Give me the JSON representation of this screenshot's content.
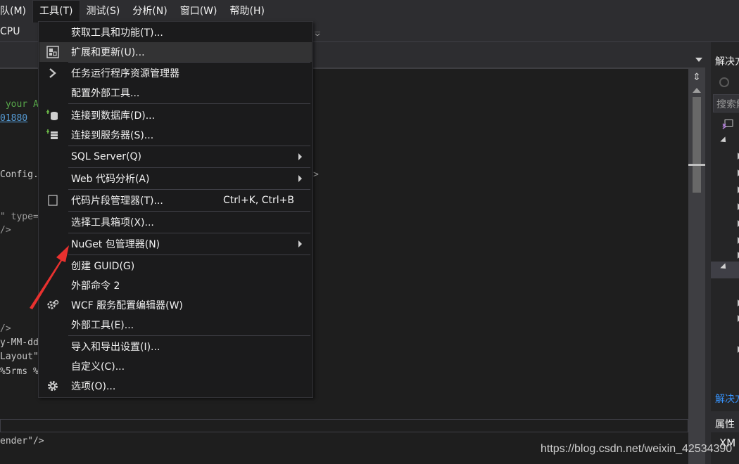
{
  "menubar": {
    "items": [
      {
        "label": "队(M)"
      },
      {
        "label": "工具(T)"
      },
      {
        "label": "测试(S)"
      },
      {
        "label": "分析(N)"
      },
      {
        "label": "窗口(W)"
      },
      {
        "label": "帮助(H)"
      }
    ]
  },
  "toolbar": {
    "platform": "CPU"
  },
  "editor": {
    "lines": [
      {
        "text": " your A",
        "style": "green"
      },
      {
        "text": "01880",
        "style": "link"
      },
      {
        "text": "Config.N",
        "style": "val"
      },
      {
        "text": "\" type=",
        "style": "gray"
      },
      {
        "text": "/>",
        "style": "gray"
      },
      {
        "text": "/>",
        "style": "gray"
      },
      {
        "text": "y-MM-dd",
        "style": "val"
      },
      {
        "text": "Layout\"",
        "style": "val"
      },
      {
        "text": "%5rms %",
        "style": "val"
      },
      {
        "text": "ender\"/>",
        "style": "val"
      }
    ],
    "overflow_glyph": ">"
  },
  "solution_explorer": {
    "title": "解决方",
    "search_placeholder": "搜索解",
    "footer": "解决方",
    "properties_title": "属性",
    "xml_label": "XM"
  },
  "tools_menu": {
    "items": [
      {
        "label": "获取工具和功能(T)...",
        "icon": ""
      },
      {
        "label": "扩展和更新(U)...",
        "icon": "extensions-icon",
        "hover": true
      },
      {
        "label": "任务运行程序资源管理器",
        "icon": "chevron-right-icon"
      },
      {
        "label": "配置外部工具...",
        "icon": ""
      },
      {
        "label": "连接到数据库(D)...",
        "icon": "database-connect-icon"
      },
      {
        "label": "连接到服务器(S)...",
        "icon": "server-connect-icon"
      },
      {
        "label": "SQL Server(Q)",
        "icon": "",
        "submenu": true
      },
      {
        "label": "Web 代码分析(A)",
        "icon": "",
        "submenu": true
      },
      {
        "label": "代码片段管理器(T)...",
        "icon": "snippet-icon",
        "shortcut": "Ctrl+K, Ctrl+B"
      },
      {
        "label": "选择工具箱项(X)...",
        "icon": ""
      },
      {
        "label": "NuGet 包管理器(N)",
        "icon": "",
        "submenu": true
      },
      {
        "label": "创建 GUID(G)",
        "icon": ""
      },
      {
        "label": "外部命令 2",
        "icon": ""
      },
      {
        "label": "WCF 服务配置编辑器(W)",
        "icon": "wcf-config-icon"
      },
      {
        "label": "外部工具(E)...",
        "icon": ""
      },
      {
        "label": "导入和导出设置(I)...",
        "icon": ""
      },
      {
        "label": "自定义(C)...",
        "icon": ""
      },
      {
        "label": "选项(O)...",
        "icon": "gear-icon"
      }
    ]
  },
  "annotation": {
    "arrow_color": "#e8312f"
  },
  "watermark": "https://blog.csdn.net/weixin_42534390"
}
